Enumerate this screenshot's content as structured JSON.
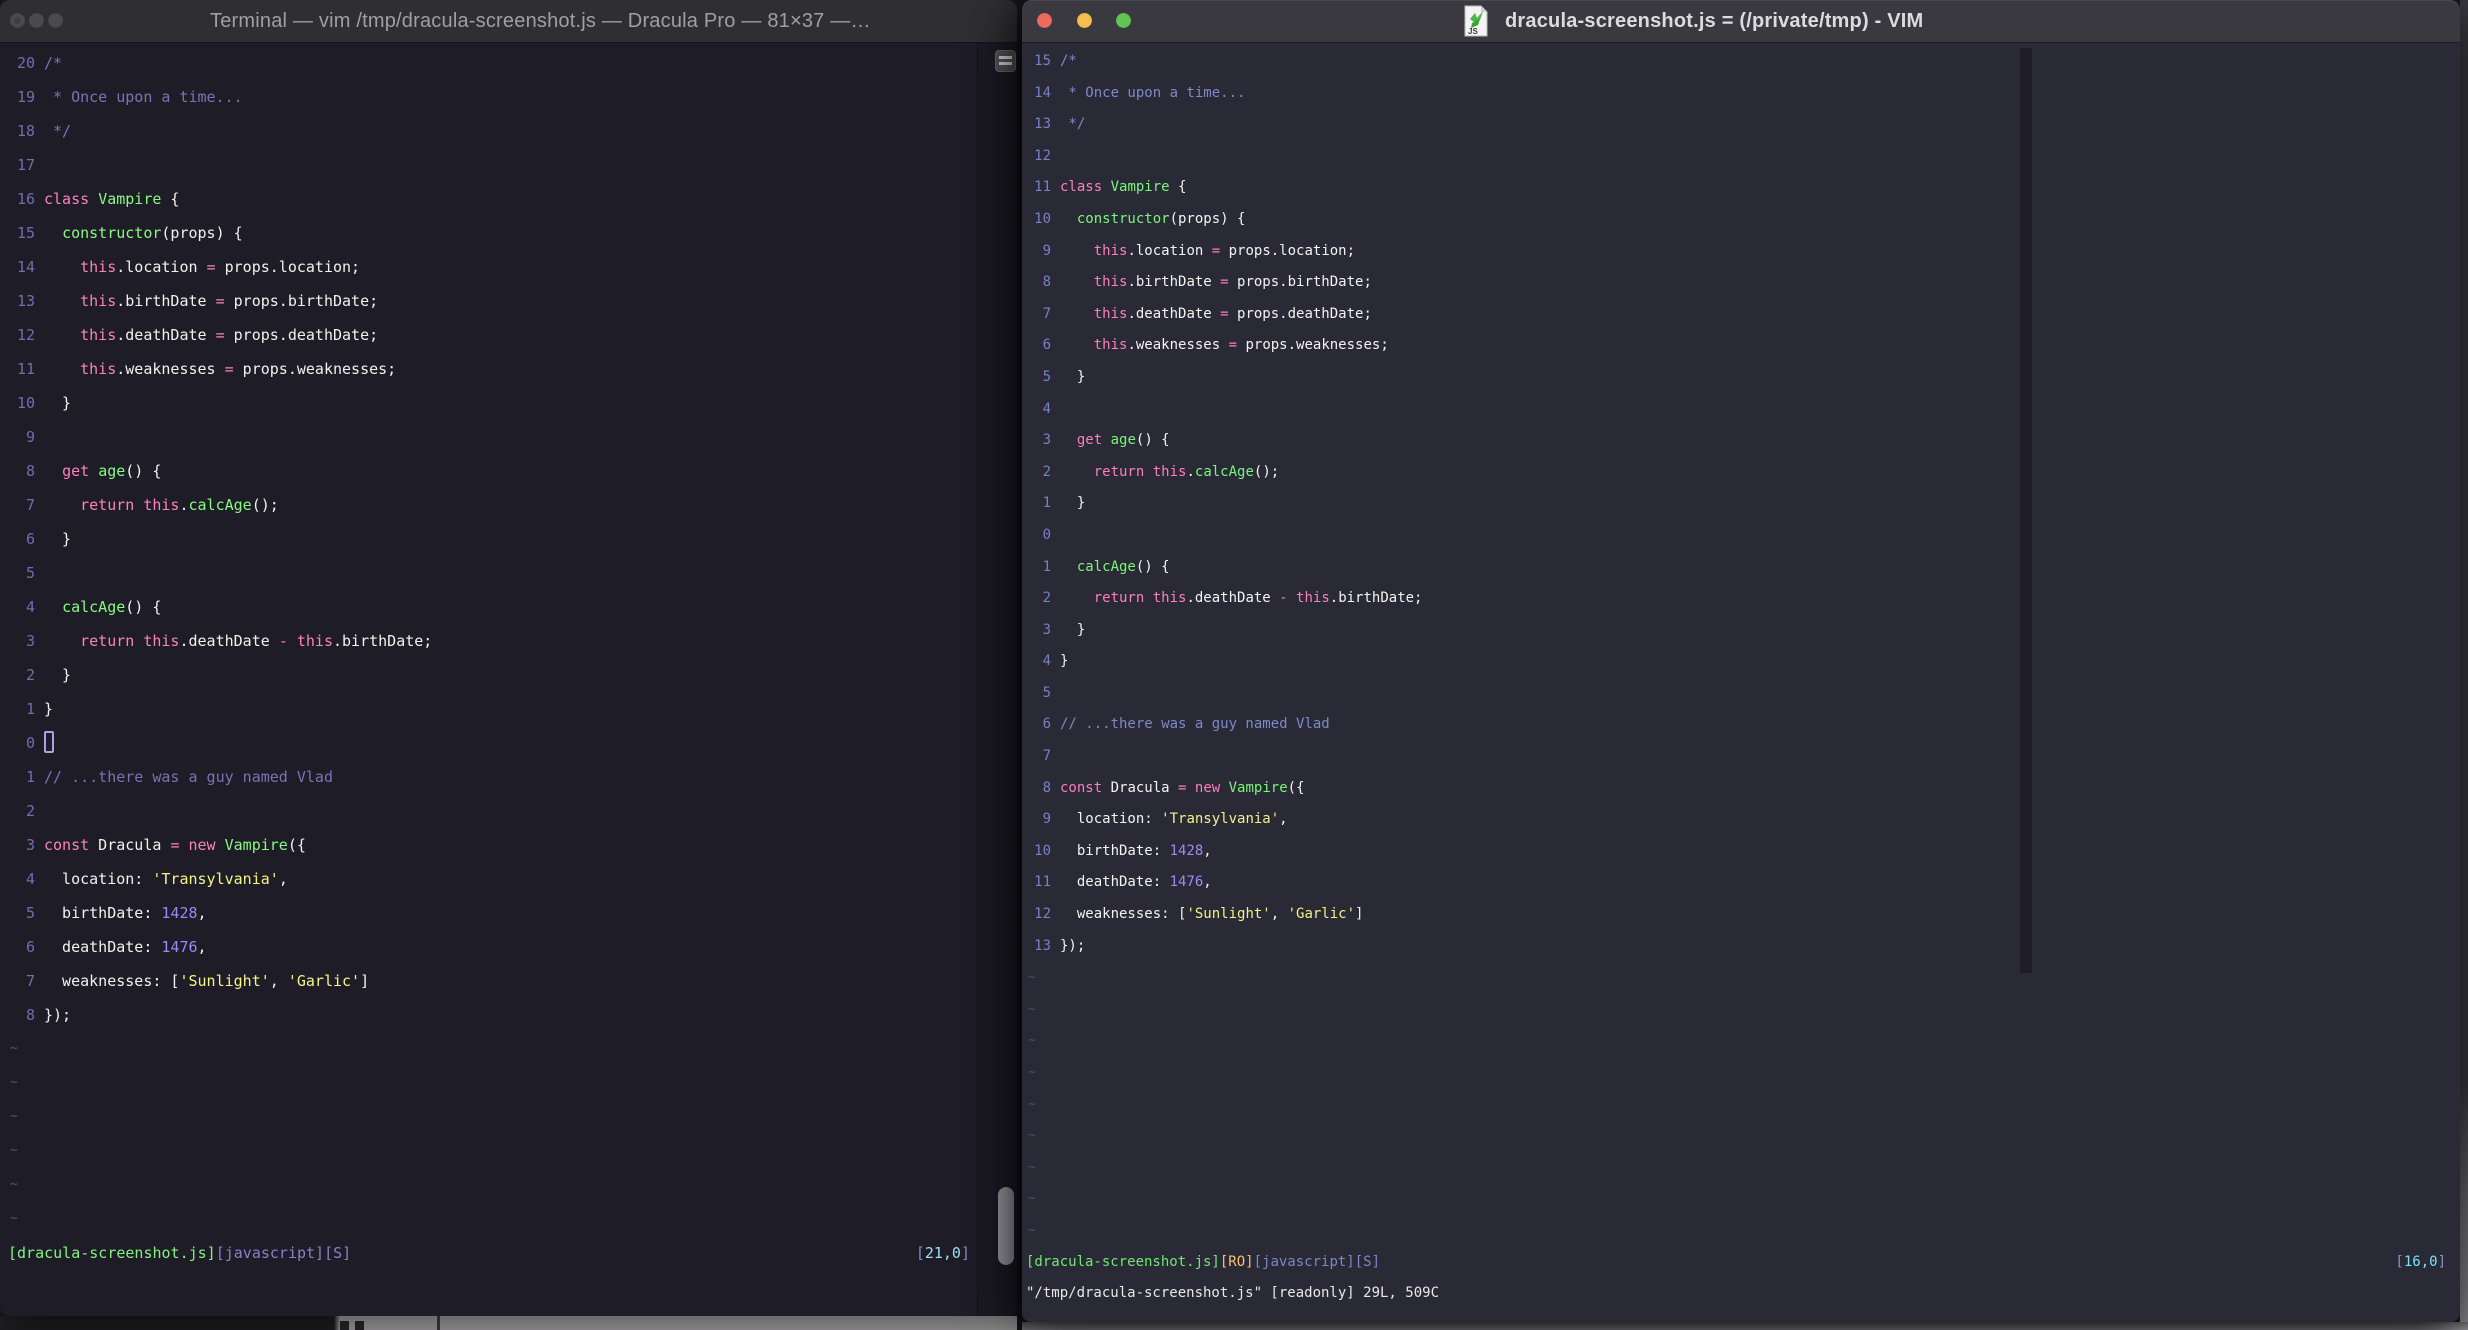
{
  "palettes": {
    "left": {
      "f": "#F2F1ED",
      "c": "#7A72B5",
      "p": "#FC81C1",
      "g": "#87FB7F",
      "y": "#F4F584",
      "u": "#9D88F7",
      "ln": "#746CAD",
      "tl": "#575070",
      "sg": "#82F47E",
      "sl": "#8781C8",
      "sb": "#8A82D6",
      "sc": "#9CDFF4"
    },
    "right": {
      "f": "#F4F3EF",
      "c": "#7D89C8",
      "p": "#FA7FC0",
      "g": "#79F777",
      "y": "#F2F286",
      "u": "#A289F5",
      "ln": "#7583C4",
      "tl": "#514D6E",
      "sg": "#70E873",
      "ro": "#FFBE74",
      "sl": "#7B87C6",
      "sb": "#8A90D8",
      "sc": "#7AE6F5",
      "cmd": "#E9E8E5"
    }
  },
  "left_window": {
    "title": "Terminal — vim /tmp/dracula-screenshot.js — Dracula Pro — 81×37 —…",
    "tilde": "~",
    "tilde_count": 6,
    "status_left": [
      [
        "[dracula-screenshot.js]",
        "sg"
      ],
      [
        "[javascript][S]",
        "sl"
      ]
    ],
    "status_right": [
      [
        "[",
        "sb"
      ],
      [
        "21,0",
        "sc"
      ],
      [
        "]",
        "sb"
      ]
    ],
    "lines": [
      {
        "n": "20",
        "s": [
          [
            "/*",
            "c"
          ]
        ]
      },
      {
        "n": "19",
        "s": [
          [
            " * Once upon a time...",
            "c"
          ]
        ]
      },
      {
        "n": "18",
        "s": [
          [
            " */",
            "c"
          ]
        ]
      },
      {
        "n": "17",
        "s": []
      },
      {
        "n": "16",
        "s": [
          [
            "class",
            "p"
          ],
          [
            " ",
            "f"
          ],
          [
            "Vampire",
            "g"
          ],
          [
            " {",
            "f"
          ]
        ]
      },
      {
        "n": "15",
        "s": [
          [
            "  ",
            "f"
          ],
          [
            "constructor",
            "g"
          ],
          [
            "(props) {",
            "f"
          ]
        ]
      },
      {
        "n": "14",
        "s": [
          [
            "    ",
            "f"
          ],
          [
            "this",
            "p"
          ],
          [
            ".location ",
            "f"
          ],
          [
            "=",
            "p"
          ],
          [
            " props.location;",
            "f"
          ]
        ]
      },
      {
        "n": "13",
        "s": [
          [
            "    ",
            "f"
          ],
          [
            "this",
            "p"
          ],
          [
            ".birthDate ",
            "f"
          ],
          [
            "=",
            "p"
          ],
          [
            " props.birthDate;",
            "f"
          ]
        ]
      },
      {
        "n": "12",
        "s": [
          [
            "    ",
            "f"
          ],
          [
            "this",
            "p"
          ],
          [
            ".deathDate ",
            "f"
          ],
          [
            "=",
            "p"
          ],
          [
            " props.deathDate;",
            "f"
          ]
        ]
      },
      {
        "n": "11",
        "s": [
          [
            "    ",
            "f"
          ],
          [
            "this",
            "p"
          ],
          [
            ".weaknesses ",
            "f"
          ],
          [
            "=",
            "p"
          ],
          [
            " props.weaknesses;",
            "f"
          ]
        ]
      },
      {
        "n": "10",
        "s": [
          [
            "  }",
            "f"
          ]
        ]
      },
      {
        "n": "9",
        "s": []
      },
      {
        "n": "8",
        "s": [
          [
            "  ",
            "f"
          ],
          [
            "get",
            "p"
          ],
          [
            " ",
            "f"
          ],
          [
            "age",
            "g"
          ],
          [
            "() {",
            "f"
          ]
        ]
      },
      {
        "n": "7",
        "s": [
          [
            "    ",
            "f"
          ],
          [
            "return",
            "p"
          ],
          [
            " ",
            "f"
          ],
          [
            "this",
            "p"
          ],
          [
            ".",
            "f"
          ],
          [
            "calcAge",
            "g"
          ],
          [
            "();",
            "f"
          ]
        ]
      },
      {
        "n": "6",
        "s": [
          [
            "  }",
            "f"
          ]
        ]
      },
      {
        "n": "5",
        "s": []
      },
      {
        "n": "4",
        "s": [
          [
            "  ",
            "f"
          ],
          [
            "calcAge",
            "g"
          ],
          [
            "() {",
            "f"
          ]
        ]
      },
      {
        "n": "3",
        "s": [
          [
            "    ",
            "f"
          ],
          [
            "return",
            "p"
          ],
          [
            " ",
            "f"
          ],
          [
            "this",
            "p"
          ],
          [
            ".deathDate ",
            "f"
          ],
          [
            "-",
            "p"
          ],
          [
            " ",
            "f"
          ],
          [
            "this",
            "p"
          ],
          [
            ".birthDate;",
            "f"
          ]
        ]
      },
      {
        "n": "2",
        "s": [
          [
            "  }",
            "f"
          ]
        ]
      },
      {
        "n": "1",
        "s": [
          [
            "}",
            "f"
          ]
        ]
      },
      {
        "n": "0",
        "s": [],
        "cursor": true
      },
      {
        "n": "1",
        "s": [
          [
            "// ...there was a guy named Vlad",
            "c"
          ]
        ]
      },
      {
        "n": "2",
        "s": []
      },
      {
        "n": "3",
        "s": [
          [
            "const",
            "p"
          ],
          [
            " Dracula ",
            "f"
          ],
          [
            "=",
            "p"
          ],
          [
            " ",
            "f"
          ],
          [
            "new",
            "p"
          ],
          [
            " ",
            "f"
          ],
          [
            "Vampire",
            "g"
          ],
          [
            "({",
            "f"
          ]
        ]
      },
      {
        "n": "4",
        "s": [
          [
            "  location: ",
            "f"
          ],
          [
            "'Transylvania'",
            "y"
          ],
          [
            ",",
            "f"
          ]
        ]
      },
      {
        "n": "5",
        "s": [
          [
            "  birthDate: ",
            "f"
          ],
          [
            "1428",
            "u"
          ],
          [
            ",",
            "f"
          ]
        ]
      },
      {
        "n": "6",
        "s": [
          [
            "  deathDate: ",
            "f"
          ],
          [
            "1476",
            "u"
          ],
          [
            ",",
            "f"
          ]
        ]
      },
      {
        "n": "7",
        "s": [
          [
            "  weaknesses: [",
            "f"
          ],
          [
            "'Sunlight'",
            "y"
          ],
          [
            ", ",
            "f"
          ],
          [
            "'Garlic'",
            "y"
          ],
          [
            "]",
            "f"
          ]
        ]
      },
      {
        "n": "8",
        "s": [
          [
            "});",
            "f"
          ]
        ]
      }
    ]
  },
  "right_window": {
    "title": "dracula-screenshot.js = (/private/tmp) - VIM",
    "icon_label": "JS",
    "tilde": "~",
    "tilde_count": 9,
    "status_left": [
      [
        "[dracula-screenshot.js]",
        "sg"
      ],
      [
        "[RO]",
        "ro"
      ],
      [
        "[javascript][S]",
        "sl"
      ]
    ],
    "status_right": [
      [
        "[",
        "sb"
      ],
      [
        "16,0",
        "sc"
      ],
      [
        "]",
        "sb"
      ]
    ],
    "command_line": "\"/tmp/dracula-screenshot.js\" [readonly] 29L, 509C",
    "lines": [
      {
        "n": "15",
        "s": [
          [
            "/*",
            "c"
          ]
        ]
      },
      {
        "n": "14",
        "s": [
          [
            " * Once upon a time...",
            "c"
          ]
        ]
      },
      {
        "n": "13",
        "s": [
          [
            " */",
            "c"
          ]
        ]
      },
      {
        "n": "12",
        "s": []
      },
      {
        "n": "11",
        "s": [
          [
            "class",
            "p"
          ],
          [
            " ",
            "f"
          ],
          [
            "Vampire",
            "g"
          ],
          [
            " {",
            "f"
          ]
        ]
      },
      {
        "n": "10",
        "s": [
          [
            "  ",
            "f"
          ],
          [
            "constructor",
            "g"
          ],
          [
            "(props) {",
            "f"
          ]
        ]
      },
      {
        "n": "9",
        "s": [
          [
            "    ",
            "f"
          ],
          [
            "this",
            "p"
          ],
          [
            ".location ",
            "f"
          ],
          [
            "=",
            "p"
          ],
          [
            " props.location;",
            "f"
          ]
        ]
      },
      {
        "n": "8",
        "s": [
          [
            "    ",
            "f"
          ],
          [
            "this",
            "p"
          ],
          [
            ".birthDate ",
            "f"
          ],
          [
            "=",
            "p"
          ],
          [
            " props.birthDate;",
            "f"
          ]
        ]
      },
      {
        "n": "7",
        "s": [
          [
            "    ",
            "f"
          ],
          [
            "this",
            "p"
          ],
          [
            ".deathDate ",
            "f"
          ],
          [
            "=",
            "p"
          ],
          [
            " props.deathDate;",
            "f"
          ]
        ]
      },
      {
        "n": "6",
        "s": [
          [
            "    ",
            "f"
          ],
          [
            "this",
            "p"
          ],
          [
            ".weaknesses ",
            "f"
          ],
          [
            "=",
            "p"
          ],
          [
            " props.weaknesses;",
            "f"
          ]
        ]
      },
      {
        "n": "5",
        "s": [
          [
            "  }",
            "f"
          ]
        ]
      },
      {
        "n": "4",
        "s": []
      },
      {
        "n": "3",
        "s": [
          [
            "  ",
            "f"
          ],
          [
            "get",
            "p"
          ],
          [
            " ",
            "f"
          ],
          [
            "age",
            "g"
          ],
          [
            "() {",
            "f"
          ]
        ]
      },
      {
        "n": "2",
        "s": [
          [
            "    ",
            "f"
          ],
          [
            "return",
            "p"
          ],
          [
            " ",
            "f"
          ],
          [
            "this",
            "p"
          ],
          [
            ".",
            "f"
          ],
          [
            "calcAge",
            "g"
          ],
          [
            "();",
            "f"
          ]
        ]
      },
      {
        "n": "1",
        "s": [
          [
            "  }",
            "f"
          ]
        ]
      },
      {
        "n": "0",
        "s": []
      },
      {
        "n": "1",
        "s": [
          [
            "  ",
            "f"
          ],
          [
            "calcAge",
            "g"
          ],
          [
            "() {",
            "f"
          ]
        ]
      },
      {
        "n": "2",
        "s": [
          [
            "    ",
            "f"
          ],
          [
            "return",
            "p"
          ],
          [
            " ",
            "f"
          ],
          [
            "this",
            "p"
          ],
          [
            ".deathDate ",
            "f"
          ],
          [
            "-",
            "p"
          ],
          [
            " ",
            "f"
          ],
          [
            "this",
            "p"
          ],
          [
            ".birthDate;",
            "f"
          ]
        ]
      },
      {
        "n": "3",
        "s": [
          [
            "  }",
            "f"
          ]
        ]
      },
      {
        "n": "4",
        "s": [
          [
            "}",
            "f"
          ]
        ]
      },
      {
        "n": "5",
        "s": []
      },
      {
        "n": "6",
        "s": [
          [
            "// ...there was a guy named Vlad",
            "c"
          ]
        ]
      },
      {
        "n": "7",
        "s": []
      },
      {
        "n": "8",
        "s": [
          [
            "const",
            "p"
          ],
          [
            " Dracula ",
            "f"
          ],
          [
            "=",
            "p"
          ],
          [
            " ",
            "f"
          ],
          [
            "new",
            "p"
          ],
          [
            " ",
            "f"
          ],
          [
            "Vampire",
            "g"
          ],
          [
            "({",
            "f"
          ]
        ]
      },
      {
        "n": "9",
        "s": [
          [
            "  location: ",
            "f"
          ],
          [
            "'Transylvania'",
            "y"
          ],
          [
            ",",
            "f"
          ]
        ]
      },
      {
        "n": "10",
        "s": [
          [
            "  birthDate: ",
            "f"
          ],
          [
            "1428",
            "u"
          ],
          [
            ",",
            "f"
          ]
        ]
      },
      {
        "n": "11",
        "s": [
          [
            "  deathDate: ",
            "f"
          ],
          [
            "1476",
            "u"
          ],
          [
            ",",
            "f"
          ]
        ]
      },
      {
        "n": "12",
        "s": [
          [
            "  weaknesses: [",
            "f"
          ],
          [
            "'Sunlight'",
            "y"
          ],
          [
            ", ",
            "f"
          ],
          [
            "'Garlic'",
            "y"
          ],
          [
            "]",
            "f"
          ]
        ]
      },
      {
        "n": "13",
        "s": [
          [
            "});",
            "f"
          ]
        ]
      }
    ]
  }
}
